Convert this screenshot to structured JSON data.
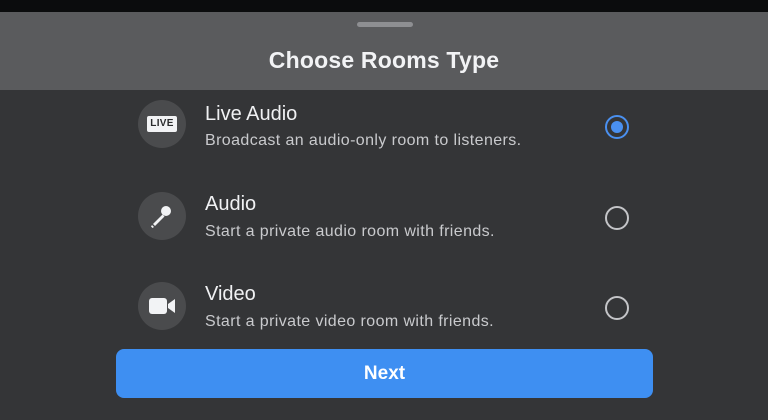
{
  "sheet": {
    "title": "Choose Rooms Type"
  },
  "options": [
    {
      "label": "Live Audio",
      "description": "Broadcast an audio-only room to listeners.",
      "icon": "live-badge-icon",
      "icon_text": "LIVE",
      "selected": true
    },
    {
      "label": "Audio",
      "description": "Start a private audio room with friends.",
      "icon": "microphone-icon",
      "selected": false
    },
    {
      "label": "Video",
      "description": "Start a private video room with friends.",
      "icon": "video-camera-icon",
      "selected": false
    }
  ],
  "next_button": {
    "label": "Next"
  },
  "colors": {
    "accent": "#3e8ff2",
    "sheet_background": "#343537",
    "header_background": "#5a5b5d"
  }
}
